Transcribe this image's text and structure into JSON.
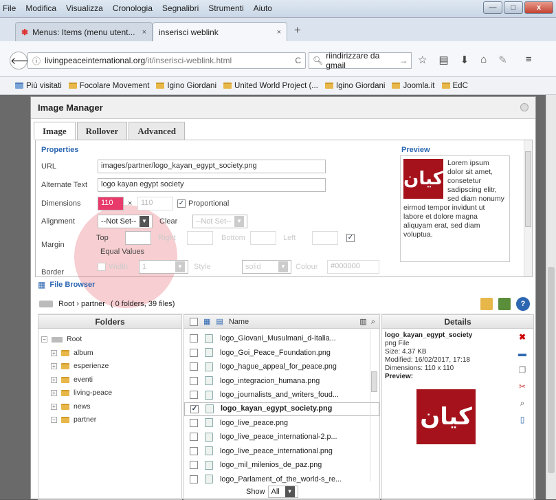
{
  "browser": {
    "menu": [
      "File",
      "Modifica",
      "Visualizza",
      "Cronologia",
      "Segnalibri",
      "Strumenti",
      "Aiuto"
    ],
    "tabs": [
      {
        "label": "Menus: Items (menu utent...",
        "close": "×"
      },
      {
        "label": "inserisci weblink",
        "close": "×"
      }
    ],
    "newtab": "+",
    "url_domain": "livingpeaceinternational.org",
    "url_path": "/it/inserisci-weblink.html",
    "search_value": "riindirizzare da gmail",
    "bookmarks": [
      "Più visitati",
      "Focolare Movement",
      "Igino Giordani",
      "United World Project (...",
      "Igino Giordani",
      "Joomla.it",
      "EdC"
    ],
    "win_min": "—",
    "win_max": "□",
    "win_close": "x"
  },
  "dialog": {
    "title": "Image Manager",
    "tabs": [
      "Image",
      "Rollover",
      "Advanced"
    ],
    "properties": {
      "section": "Properties",
      "url_label": "URL",
      "url_value": "images/partner/logo_kayan_egypt_society.png",
      "alt_label": "Alternate Text",
      "alt_value": "logo kayan egypt society",
      "dim_label": "Dimensions",
      "width": "110",
      "times": "×",
      "height": "110",
      "proportional": "Proportional",
      "align_label": "Alignment",
      "align_value": "--Not Set--",
      "clear_label": "Clear",
      "clear_value": "--Not Set--",
      "margin_label": "Margin",
      "top": "Top",
      "right": "Right",
      "bottom": "Bottom",
      "left": "Left",
      "equal": "Equal Values",
      "border_label": "Border",
      "b_width": "Width",
      "b_width_val": "1",
      "b_style": "Style",
      "b_style_val": "solid",
      "b_colour": "Colour",
      "b_colour_val": "#000000"
    },
    "preview": {
      "section": "Preview",
      "logo_text": "كيان",
      "lorem": "Lorem ipsum dolor sit amet, consetetur sadipscing elitr, sed diam nonumy eirmod tempor invidunt ut labore et dolore magna aliquyam erat, sed diam voluptua."
    },
    "browser": {
      "title": "File Browser",
      "path": "Root › partner",
      "counts": "( 0 folders, 39 files)",
      "folders_head": "Folders",
      "name_head": "Name",
      "details_head": "Details",
      "tree": [
        "Root",
        "album",
        "esperienze",
        "eventi",
        "living-peace",
        "news",
        "partner"
      ],
      "files": [
        "logo_Giovani_Musulmani_d-Italia...",
        "logo_Goi_Peace_Foundation.png",
        "logo_hague_appeal_for_peace.png",
        "logo_integracion_humana.png",
        "logo_journalists_and_writers_foud...",
        "logo_kayan_egypt_society.png",
        "logo_live_peace.png",
        "logo_live_peace_international-2.p...",
        "logo_live_peace_international.png",
        "logo_mil_milenios_de_paz.png",
        "logo_Parlament_of_the_world-s_re..."
      ],
      "selected_index": 5,
      "show_label": "Show",
      "show_value": "All",
      "details": {
        "name": "logo_kayan_egypt_society",
        "type": "png File",
        "size": "Size: 4.37 KB",
        "modified": "Modified: 16/02/2017, 17:18",
        "dimensions": "Dimensions: 110 x 110",
        "preview": "Preview:"
      }
    }
  }
}
